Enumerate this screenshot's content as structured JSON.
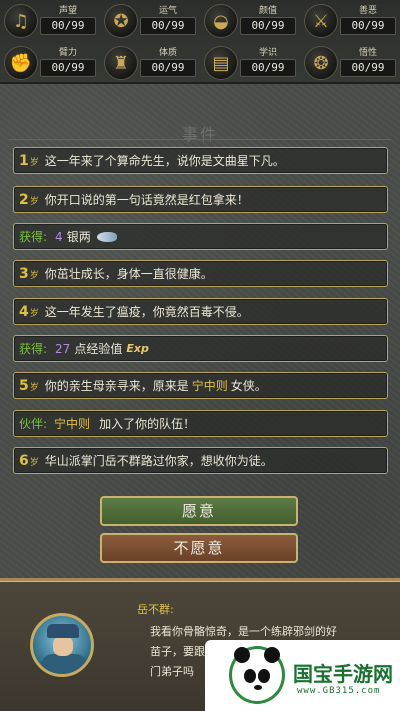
{
  "stats": [
    {
      "name": "声望",
      "value": "00/99",
      "icon": "lute-icon"
    },
    {
      "name": "运气",
      "value": "00/99",
      "icon": "toad-icon"
    },
    {
      "name": "颜值",
      "value": "00/99",
      "icon": "fan-icon"
    },
    {
      "name": "善恶",
      "value": "00/99",
      "icon": "crossed-swords-icon"
    },
    {
      "name": "臂力",
      "value": "00/99",
      "icon": "fist-icon"
    },
    {
      "name": "体质",
      "value": "00/99",
      "icon": "warrior-icon"
    },
    {
      "name": "学识",
      "value": "00/99",
      "icon": "books-icon"
    },
    {
      "name": "悟性",
      "value": "00/99",
      "icon": "brain-icon"
    }
  ],
  "events": {
    "title": "事件",
    "items": [
      {
        "kind": "age",
        "age": "1",
        "unit": "岁",
        "text": "这一年来了个算命先生，说你是文曲星下凡。"
      },
      {
        "kind": "age",
        "age": "2",
        "unit": "岁",
        "text": "你开口说的第一句话竟然是红包拿来！"
      },
      {
        "kind": "gain",
        "label": "获得:",
        "amount": "4",
        "item": "银两",
        "icon": "silver-fish-icon"
      },
      {
        "kind": "age",
        "age": "3",
        "unit": "岁",
        "text": "你茁壮成长，身体一直很健康。"
      },
      {
        "kind": "age",
        "age": "4",
        "unit": "岁",
        "text": "这一年发生了瘟疫，你竟然百毒不侵。"
      },
      {
        "kind": "gain",
        "label": "获得:",
        "amount": "27",
        "item": "点经验值",
        "badge": "Exp"
      },
      {
        "kind": "age",
        "age": "5",
        "unit": "岁",
        "pre": "你的亲生母亲寻来，原来是",
        "name": "宁中则",
        "post": "女侠。"
      },
      {
        "kind": "partner",
        "label": "伙伴:",
        "name": "宁中则",
        "text": "加入了你的队伍！"
      },
      {
        "kind": "age",
        "age": "6",
        "unit": "岁",
        "text": "华山派掌门岳不群路过你家，想收你为徒。"
      }
    ]
  },
  "buttons": {
    "accept": "愿意",
    "decline": "不愿意"
  },
  "dialog": {
    "speaker": "岳不群:",
    "lines": [
      "我看你骨骼惊奇，是一个练辟邪剑的好",
      "苗子，要跟",
      "门弟子吗"
    ]
  },
  "watermark": {
    "site": "国宝手游网",
    "url": "www.GB315.com"
  },
  "colors": {
    "gold_border": "#b7a35c",
    "age_prefix": "#e0c23a",
    "gain_label": "#78c13c",
    "number": "#b489e0",
    "accept_bg": "#5e7a44",
    "decline_bg": "#8a5c3d"
  }
}
